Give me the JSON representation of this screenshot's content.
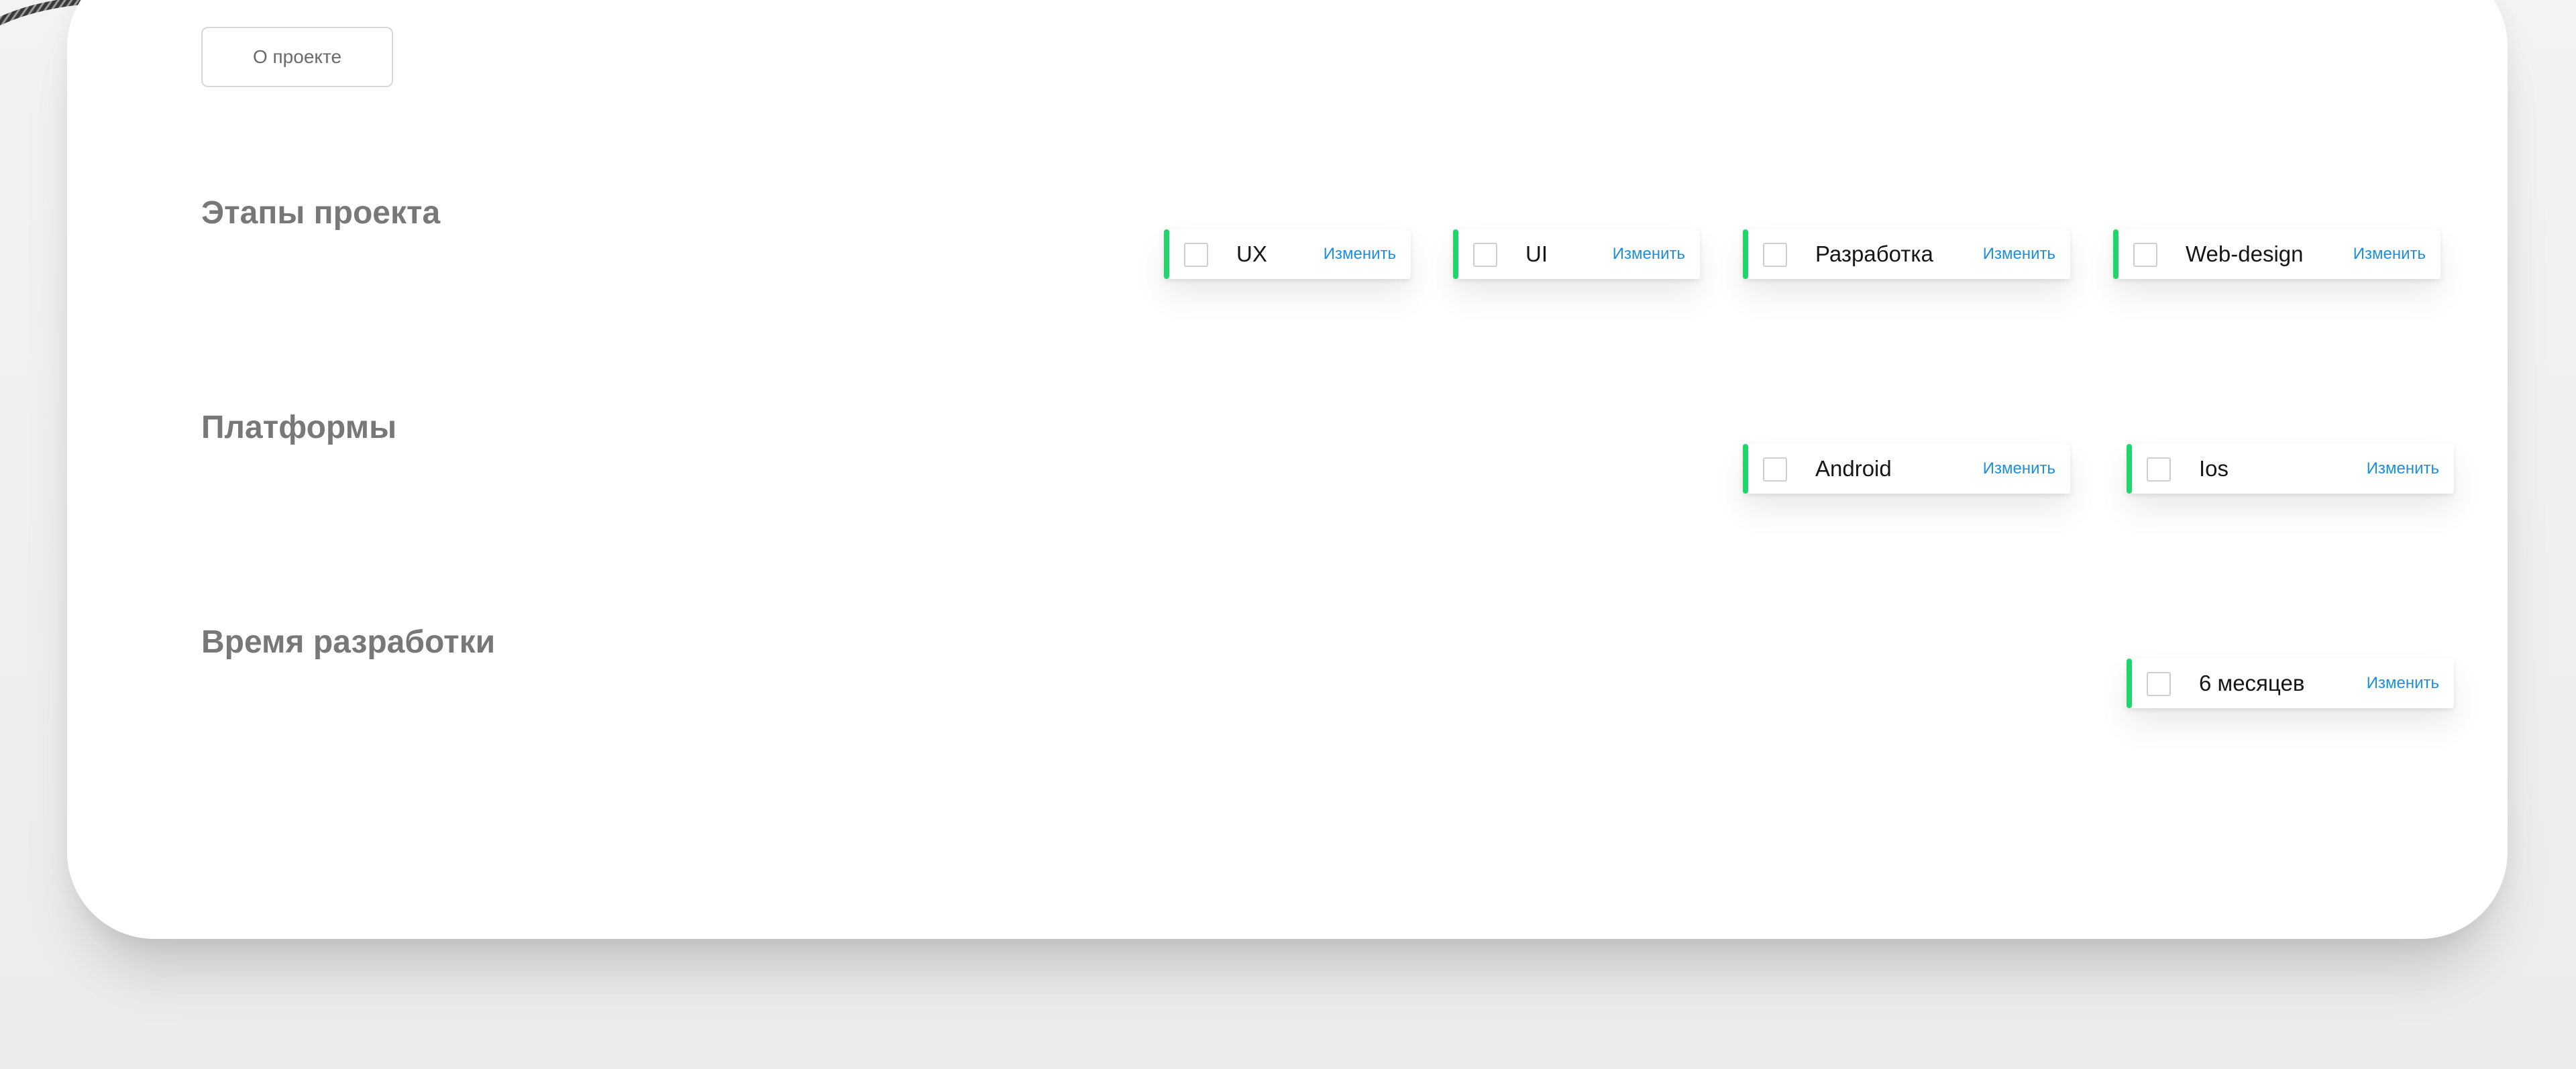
{
  "colors": {
    "accent": "#1ed66c",
    "link": "#1a8fe0",
    "title": "#787878"
  },
  "about_button": {
    "label": "О проекте"
  },
  "sections": {
    "stages": {
      "title": "Этапы проекта",
      "chips": [
        {
          "label": "UX",
          "action": "Изменить"
        },
        {
          "label": "UI",
          "action": "Изменить"
        },
        {
          "label": "Разработка",
          "action": "Изменить"
        },
        {
          "label": "Web-design",
          "action": "Изменить"
        }
      ]
    },
    "platforms": {
      "title": "Платформы",
      "chips": [
        {
          "label": "Android",
          "action": "Изменить"
        },
        {
          "label": "Ios",
          "action": "Изменить"
        }
      ]
    },
    "duration": {
      "title": "Время разработки",
      "chips": [
        {
          "label": "6 месяцев",
          "action": "Изменить"
        }
      ]
    }
  }
}
